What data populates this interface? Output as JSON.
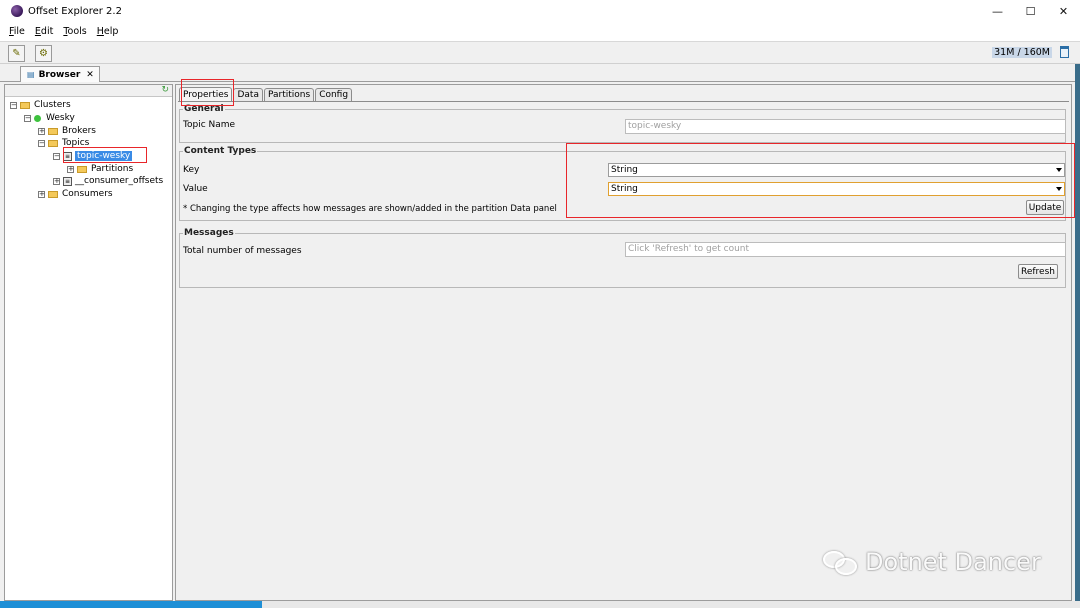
{
  "window": {
    "title": "Offset Explorer  2.2",
    "minimize": "—",
    "maximize": "☐",
    "close": "✕"
  },
  "menu": [
    {
      "key": "F",
      "rest": "ile"
    },
    {
      "key": "E",
      "rest": "dit"
    },
    {
      "key": "T",
      "rest": "ools"
    },
    {
      "key": "H",
      "rest": "elp"
    }
  ],
  "toolbar": {
    "memory": "31M / 160M"
  },
  "browser_tab": {
    "label": "Browser",
    "close": "✕"
  },
  "tree": {
    "clusters": "Clusters",
    "cluster_name": "Wesky",
    "brokers": "Brokers",
    "topics": "Topics",
    "selected_topic": "topic-wesky",
    "partitions": "Partitions",
    "consumer_offsets": "__consumer_offsets",
    "consumers": "Consumers"
  },
  "tabs": [
    "Properties",
    "Data",
    "Partitions",
    "Config"
  ],
  "general": {
    "title": "General",
    "topic_name_label": "Topic Name",
    "topic_name_value": "topic-wesky"
  },
  "content_types": {
    "title": "Content Types",
    "key_label": "Key",
    "key_value": "String",
    "value_label": "Value",
    "value_value": "String",
    "note": "* Changing the type affects how messages are shown/added in the partition Data panel",
    "update_button": "Update"
  },
  "messages": {
    "title": "Messages",
    "total_label": "Total number of messages",
    "total_placeholder": "Click 'Refresh' to get count",
    "refresh_button": "Refresh"
  },
  "watermark": "Dotnet Dancer"
}
